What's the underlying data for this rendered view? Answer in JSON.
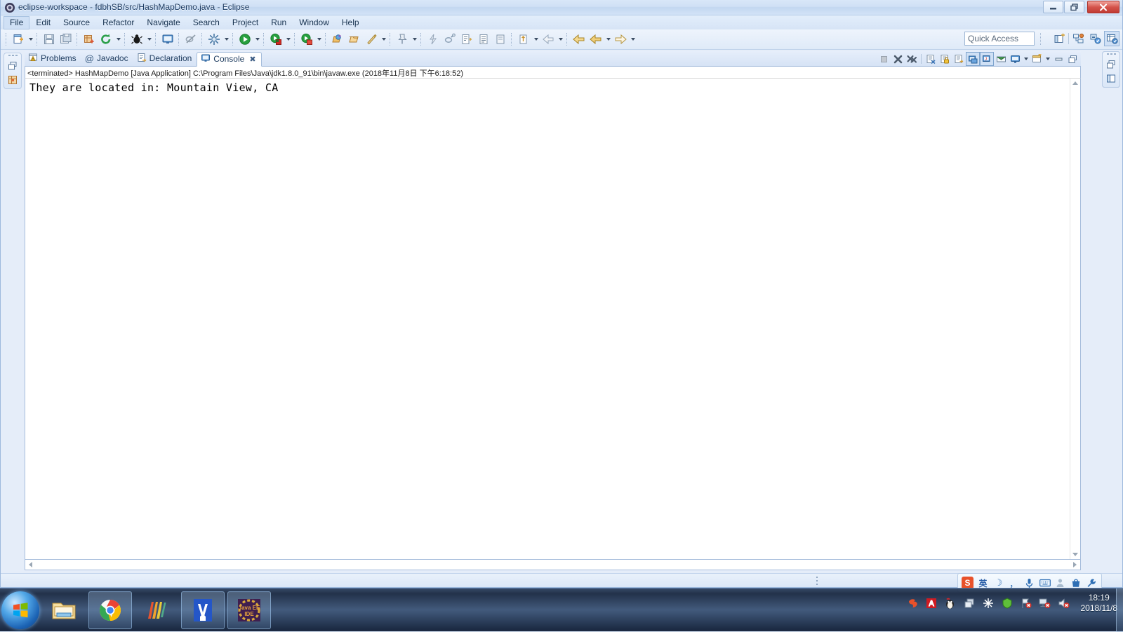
{
  "window": {
    "title": "eclipse-workspace - fdbhSB/src/HashMapDemo.java - Eclipse",
    "app_icon": "eclipse-icon",
    "controls": {
      "minimize": "minimize-button",
      "restore": "restore-button",
      "close": "close-button"
    }
  },
  "menubar": {
    "items": [
      {
        "label": "File",
        "selected": true
      },
      {
        "label": "Edit",
        "selected": false
      },
      {
        "label": "Source",
        "selected": false
      },
      {
        "label": "Refactor",
        "selected": false
      },
      {
        "label": "Navigate",
        "selected": false
      },
      {
        "label": "Search",
        "selected": false
      },
      {
        "label": "Project",
        "selected": false
      },
      {
        "label": "Run",
        "selected": false
      },
      {
        "label": "Window",
        "selected": false
      },
      {
        "label": "Help",
        "selected": false
      }
    ]
  },
  "toolbar": {
    "quick_access_placeholder": "Quick Access",
    "quick_access_value": "",
    "items": [
      "new-wizard-icon",
      "new-dropdown-arrow",
      "save-icon",
      "save-all-icon",
      "new-java-package-icon",
      "refresh-icon",
      "refresh-dropdown-arrow",
      "debug-last-icon",
      "debug-dropdown-arrow",
      "open-console-icon",
      "skip-breakpoints-icon",
      "external-tools-icon",
      "external-tools-dropdown-arrow",
      "run-icon",
      "run-dropdown-arrow",
      "run-as-java-icon",
      "run-as-dropdown-arrow",
      "coverage-icon",
      "coverage-dropdown-arrow",
      "open-type-icon",
      "open-task-icon",
      "search-icon",
      "search-dropdown-arrow",
      "pin-editor-icon",
      "pin-dropdown-arrow",
      "toggle-mark-occurrences-icon",
      "link-editor-icon",
      "next-annotation-icon",
      "previous-annotation-icon",
      "last-edit-icon",
      "next-edit-icon",
      "next-edit-dropdown-arrow",
      "back-icon",
      "forward-icon",
      "forward-dropdown-arrow",
      "next-nav-icon",
      "next-nav-dropdown-arrow"
    ],
    "perspectives": [
      {
        "name": "open-perspective-icon",
        "active": false
      },
      {
        "name": "perspective-java-icon",
        "active": false
      },
      {
        "name": "perspective-java-browsing-icon",
        "active": false
      },
      {
        "name": "perspective-java-ee-icon",
        "active": true
      }
    ]
  },
  "left_trim": {
    "restore_label": "restore-view-icon",
    "view_icon": "package-explorer-icon"
  },
  "right_trim": [
    {
      "restore": "restore-view-icon",
      "view_icon": "outline-view-icon"
    },
    {
      "restore": "restore-view-icon",
      "view_icon": "task-list-icon"
    },
    {
      "restore": "restore-view-icon",
      "view_icon": "properties-view-icon"
    }
  ],
  "console_view": {
    "tabs": [
      {
        "label": "Problems",
        "icon": "problems-icon",
        "active": false,
        "closable": false
      },
      {
        "label": "Javadoc",
        "icon": "javadoc-icon",
        "active": false,
        "closable": false
      },
      {
        "label": "Declaration",
        "icon": "declaration-icon",
        "active": false,
        "closable": false
      },
      {
        "label": "Console",
        "icon": "console-icon",
        "active": true,
        "closable": true,
        "close_glyph": "✖"
      }
    ],
    "toolbar_buttons": [
      {
        "name": "terminate-icon",
        "enabled": false,
        "toggled": false
      },
      {
        "name": "remove-launch-icon",
        "enabled": true,
        "toggled": false
      },
      {
        "name": "remove-all-terminated-icon",
        "enabled": true,
        "toggled": false
      },
      {
        "name": "clear-console-icon",
        "enabled": true,
        "toggled": false
      },
      {
        "name": "scroll-lock-icon",
        "enabled": true,
        "toggled": false
      },
      {
        "name": "word-wrap-icon",
        "enabled": true,
        "toggled": false
      },
      {
        "name": "pin-console-icon",
        "enabled": true,
        "toggled": true
      },
      {
        "name": "display-selected-console-icon",
        "enabled": true,
        "toggled": true
      },
      {
        "name": "open-console-icon",
        "enabled": true,
        "toggled": false
      },
      {
        "name": "new-console-view-icon",
        "enabled": true,
        "toggled": false
      },
      {
        "name": "new-console-dropdown-arrow",
        "enabled": true,
        "toggled": false
      },
      {
        "name": "view-menu-icon",
        "enabled": true,
        "toggled": false
      },
      {
        "name": "view-menu-dropdown-arrow",
        "enabled": true,
        "toggled": false
      },
      {
        "name": "minimize-view-icon",
        "enabled": true,
        "toggled": false
      },
      {
        "name": "maximize-view-icon",
        "enabled": true,
        "toggled": false
      }
    ],
    "status_line": "<terminated> HashMapDemo [Java Application] C:\\Program Files\\Java\\jdk1.8.0_91\\bin\\javaw.exe (2018年11月8日 下午6:18:52)",
    "output_lines": [
      "They are located in: Mountain View, CA"
    ]
  },
  "statusbar": {
    "text": ""
  },
  "ime_bar": {
    "items": [
      {
        "name": "sogou-logo-icon",
        "glyph": "S"
      },
      {
        "name": "language-mode-icon",
        "glyph": "英"
      },
      {
        "name": "moon-mode-icon",
        "glyph": "☽"
      },
      {
        "name": "punctuation-icon",
        "glyph": "，"
      },
      {
        "name": "voice-input-icon",
        "glyph": "🎙"
      },
      {
        "name": "soft-keyboard-icon",
        "glyph": "⌨"
      },
      {
        "name": "user-icon",
        "glyph": "♟"
      },
      {
        "name": "toolbox-icon",
        "glyph": "🛍"
      },
      {
        "name": "settings-icon",
        "glyph": "🔧"
      }
    ]
  },
  "taskbar": {
    "start": "start-orb-icon",
    "pinned": [
      {
        "name": "file-explorer-icon",
        "framed": false
      },
      {
        "name": "google-chrome-icon",
        "framed": true
      },
      {
        "name": "colorful-stripes-app-icon",
        "framed": false
      },
      {
        "name": "wps-writer-icon",
        "framed": true
      },
      {
        "name": "eclipse-java-ee-ide-icon",
        "framed": true,
        "label": "Java EE IDE"
      }
    ],
    "tray": [
      {
        "name": "sogou-tray-icon",
        "glyph": "S"
      },
      {
        "name": "adobe-tray-icon",
        "glyph": "A"
      },
      {
        "name": "qq-tray-icon",
        "glyph": "🐧"
      },
      {
        "name": "window-stack-tray-icon",
        "glyph": "❐"
      },
      {
        "name": "snowflake-tray-icon",
        "glyph": "✳"
      },
      {
        "name": "shield-tray-icon",
        "glyph": "◆"
      },
      {
        "name": "flag-error-tray-icon",
        "glyph": "⚑"
      },
      {
        "name": "network-error-tray-icon",
        "glyph": "🖧"
      },
      {
        "name": "volume-muted-tray-icon",
        "glyph": "🔇"
      }
    ],
    "clock": {
      "time": "18:19",
      "date": "2018/11/8"
    }
  }
}
